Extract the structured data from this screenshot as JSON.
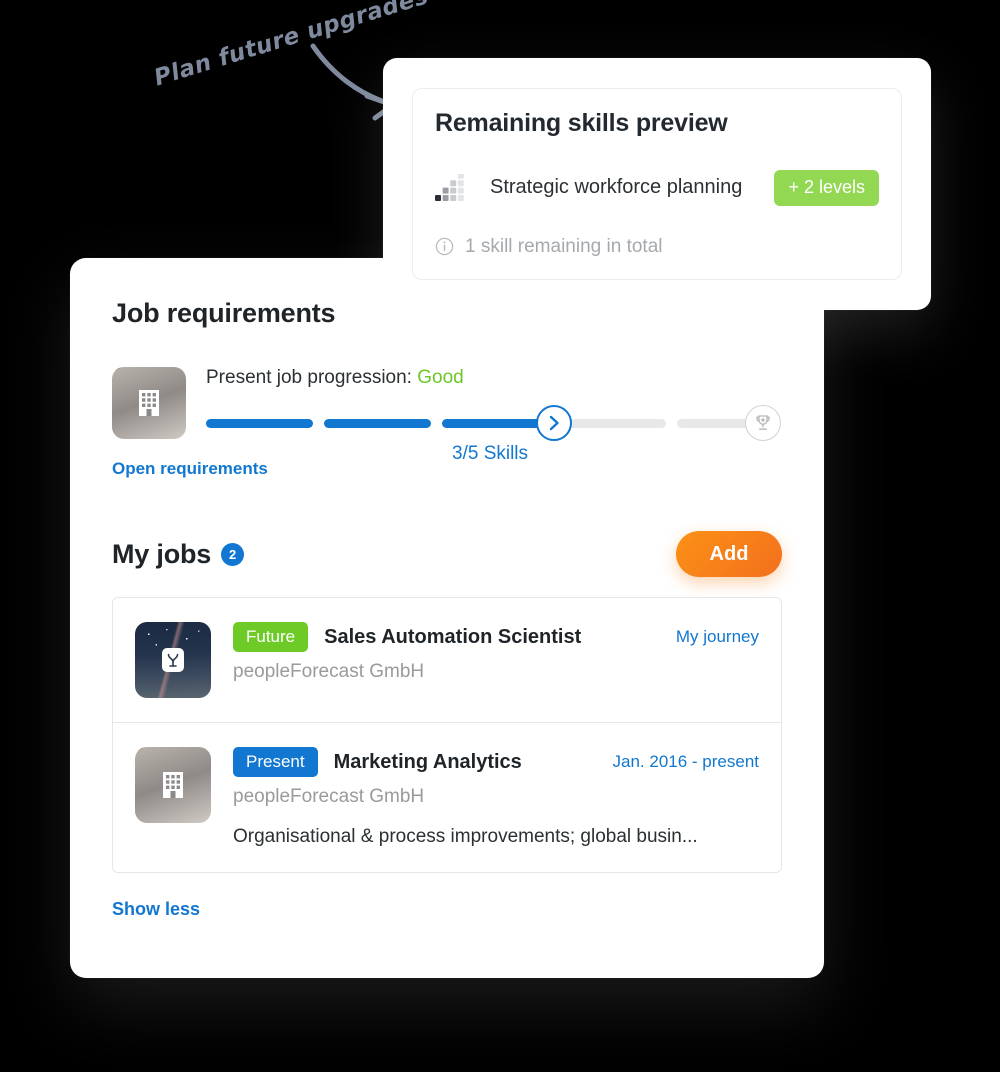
{
  "annotation": {
    "text": "Plan future upgrades",
    "color": "#7f8a9e",
    "arrow_icon": "curved-arrow-icon"
  },
  "preview_card": {
    "title": "Remaining skills preview",
    "skill": {
      "icon": "skill-level-bars-icon",
      "name": "Strategic workforce planning",
      "levels_badge": "+ 2 levels",
      "badge_color": "#93d852"
    },
    "footer": {
      "icon": "info-circle-icon",
      "text": "1 skill remaining in total"
    }
  },
  "main_card": {
    "title": "Job requirements",
    "progression": {
      "thumbnail_icon": "building-icon",
      "label_prefix": "Present job progression: ",
      "status": "Good",
      "status_color": "#6ec72a",
      "skills_count": "3/5 Skills",
      "filled_segments": 3,
      "empty_segments": 2,
      "chevron_icon": "chevron-right-icon",
      "goal_icon": "trophy-icon",
      "accent_color": "#1277d0",
      "open_requirements_label": "Open requirements"
    },
    "my_jobs": {
      "title": "My jobs",
      "count": "2",
      "add_button_label": "Add",
      "jobs": [
        {
          "thumbnail_icon": "company-logo-icon",
          "badge": "Future",
          "badge_color": "#6ecb27",
          "title": "Sales Automation Scientist",
          "company": "peopleForecast GmbH",
          "action": "My journey",
          "description": ""
        },
        {
          "thumbnail_icon": "building-icon",
          "badge": "Present",
          "badge_color": "#1277d0",
          "title": "Marketing Analytics",
          "company": "peopleForecast GmbH",
          "action": "Jan. 2016 - present",
          "description": "Organisational & process improvements; global busin..."
        }
      ]
    },
    "show_less_label": "Show less"
  }
}
